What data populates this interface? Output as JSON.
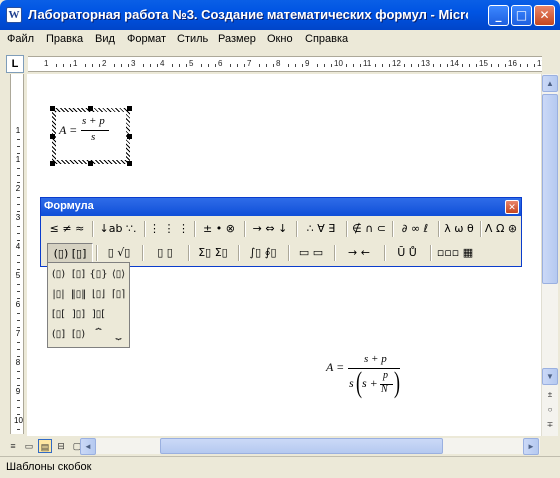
{
  "window": {
    "title": "Лабораторная работа №3. Создание математических формул - Micro",
    "app_icon": "W"
  },
  "menu": [
    "Файл",
    "Правка",
    "Вид",
    "Формат",
    "Стиль",
    "Размер",
    "Окно",
    "Справка"
  ],
  "ruler": {
    "corner": "L",
    "h_numbers": [
      "1",
      "1",
      "2",
      "3",
      "4",
      "5",
      "6",
      "7",
      "8",
      "9",
      "10",
      "11",
      "12",
      "13",
      "14",
      "15",
      "16",
      "17"
    ],
    "v_numbers": [
      "1",
      "1",
      "2",
      "3",
      "4",
      "5",
      "6",
      "7",
      "8",
      "9",
      "10",
      "11"
    ]
  },
  "formula_small": {
    "lhs": "A =",
    "numerator": "s + p",
    "denominator": "s"
  },
  "formula_large": {
    "lhs": "A =",
    "numerator": "s + p",
    "denom_s": "s",
    "inner_s": "s +",
    "inner_num": "p",
    "inner_den": "N"
  },
  "palette": {
    "title": "Формула",
    "close": "✕",
    "row1": [
      "≤ ≠ ≈",
      "↓ab ∵.",
      "⋮ ⋮ ⋮",
      "± • ⊗",
      "→ ⇔ ↓",
      "∴ ∀ ∃",
      "∉ ∩ ⊂",
      "∂ ∞ ℓ",
      "λ ω θ",
      "Λ Ω ⊛"
    ],
    "row2": [
      "(▯) [▯]",
      "▯ √▯",
      "▯ ▯",
      "Σ▯ Σ▯",
      "∫▯ ∮▯",
      "▭ ▭",
      "→ ←",
      "Ū Ů",
      "▫▫▫ ▦"
    ]
  },
  "brackets_menu": [
    [
      "(▯)",
      "[▯]",
      "{▯}",
      "⟨▯⟩"
    ],
    [
      "|▯|",
      "‖▯‖",
      "⌊▯⌋",
      "⌈▯⌉"
    ],
    [
      "[▯[",
      "]▯]",
      "]▯["
    ],
    [
      "(▯]",
      "[▯)",
      "⏞",
      "⏟"
    ]
  ],
  "scroll": {
    "up": "▲",
    "down": "▼",
    "prev": "±",
    "select": "○",
    "next": "∓",
    "left": "◄",
    "right": "►"
  },
  "views": [
    "≡",
    "▭",
    "▤",
    "⊟",
    "▢"
  ],
  "status": {
    "text": "Шаблоны скобок"
  }
}
